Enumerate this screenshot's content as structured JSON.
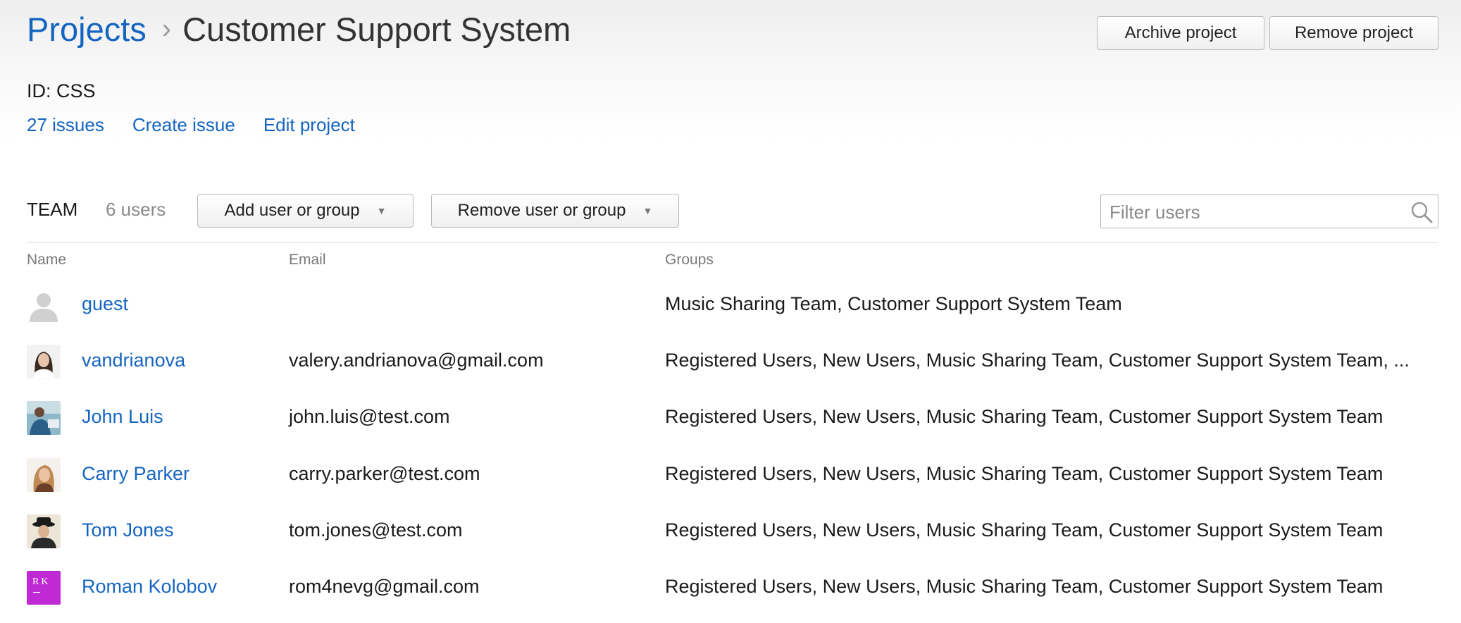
{
  "breadcrumb": {
    "root": "Projects",
    "separator": "›",
    "current": "Customer Support System"
  },
  "actions": {
    "archive": "Archive project",
    "remove": "Remove project"
  },
  "project": {
    "id_line": "ID: CSS",
    "links": {
      "issues": "27 issues",
      "create": "Create issue",
      "edit": "Edit project"
    }
  },
  "team": {
    "label": "TEAM",
    "count": "6 users",
    "add_button": "Add user or group",
    "remove_button": "Remove user or group",
    "filter_placeholder": "Filter users"
  },
  "table": {
    "headers": {
      "name": "Name",
      "email": "Email",
      "groups": "Groups"
    },
    "rows": [
      {
        "name": "guest",
        "email": "",
        "groups": "Music Sharing Team, Customer Support System Team",
        "avatar": "default-user-icon"
      },
      {
        "name": "vandrianova",
        "email": "valery.andrianova@gmail.com",
        "groups": "Registered Users, New Users, Music Sharing Team, Customer Support System Team, ...",
        "avatar": "photo"
      },
      {
        "name": "John Luis",
        "email": "john.luis@test.com",
        "groups": "Registered Users, New Users, Music Sharing Team, Customer Support System Team",
        "avatar": "photo"
      },
      {
        "name": "Carry Parker",
        "email": "carry.parker@test.com",
        "groups": "Registered Users, New Users, Music Sharing Team, Customer Support System Team",
        "avatar": "photo"
      },
      {
        "name": "Tom Jones",
        "email": "tom.jones@test.com",
        "groups": "Registered Users, New Users, Music Sharing Team, Customer Support System Team",
        "avatar": "photo"
      },
      {
        "name": "Roman Kolobov",
        "email": "rom4nevg@gmail.com",
        "groups": "Registered Users, New Users, Music Sharing Team, Customer Support System Team",
        "avatar": "initials",
        "initials": "RK"
      }
    ]
  },
  "colors": {
    "link": "#1565c0",
    "muted": "#8a8a8a",
    "rk_avatar": "#c02ad4"
  }
}
